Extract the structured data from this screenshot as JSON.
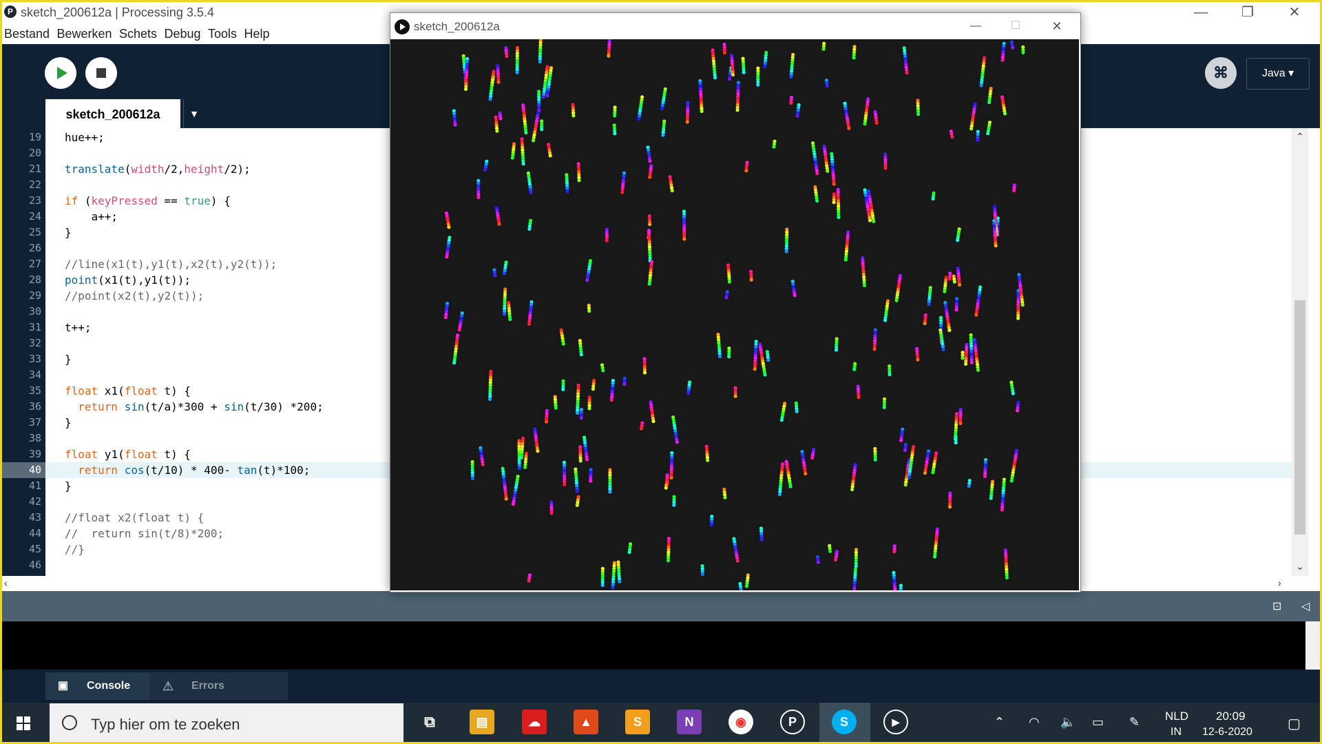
{
  "ide": {
    "title": "sketch_200612a | Processing 3.5.4",
    "menu": [
      "Bestand",
      "Bewerken",
      "Schets",
      "Debug",
      "Tools",
      "Help"
    ],
    "mode": "Java ▾",
    "tab": "sketch_200612a",
    "line_numbers": [
      "19",
      "20",
      "21",
      "22",
      "23",
      "24",
      "25",
      "26",
      "27",
      "28",
      "29",
      "30",
      "31",
      "32",
      "33",
      "34",
      "35",
      "36",
      "37",
      "38",
      "39",
      "40",
      "41",
      "42",
      "43",
      "44",
      "45",
      "46"
    ],
    "active_line": "40",
    "code_lines": [
      "hue++;",
      "",
      "translate(width/2,height/2);",
      "",
      "if (keyPressed == true) {",
      "    a++;",
      "}",
      "",
      "//line(x1(t),y1(t),x2(t),y2(t));",
      "point(x1(t),y1(t));",
      "//point(x2(t),y2(t));",
      "",
      "t++;",
      "",
      "}",
      "",
      "float x1(float t) {",
      "  return sin(t/a)*300 + sin(t/30) *200;",
      "}",
      "",
      "float y1(float t) {",
      "  return cos(t/10) * 400- tan(t)*100;",
      "}",
      "",
      "//float x2(float t) {",
      "//  return sin(t/8)*200;",
      "//}",
      ""
    ],
    "console_tabs": [
      "Console",
      "Errors"
    ]
  },
  "sketch": {
    "title": "sketch_200612a"
  },
  "taskbar": {
    "search_placeholder": "Typ hier om te zoeken",
    "lang_line1": "NLD",
    "lang_line2": "IN",
    "time": "20:09",
    "date": "12-6-2020"
  },
  "colors": {
    "toolbar": "#0f2132",
    "canvas": "#181818",
    "run": "#2a9d3c",
    "frame": "#e8d820"
  }
}
